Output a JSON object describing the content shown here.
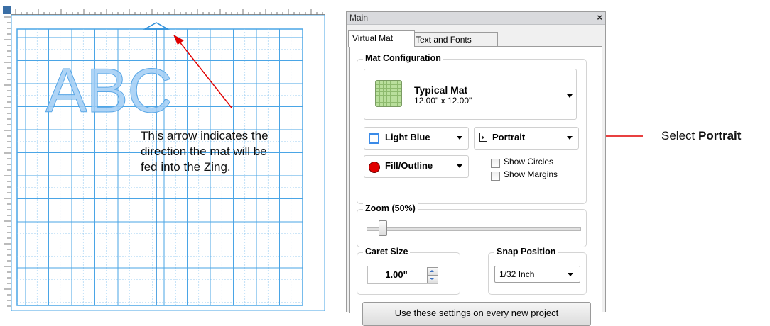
{
  "mat_view": {
    "letters": "ABC",
    "annotation": {
      "line1": "This arrow indicates the",
      "line2": "direction the mat will be",
      "line3": "fed into the Zing."
    },
    "colors": {
      "grid": "#4aa5e6",
      "letters": "#7fc0f0",
      "arrow": "#e00000"
    }
  },
  "settings_window": {
    "title": "Main",
    "close_glyph": "×",
    "tabs": [
      {
        "label": "Virtual Mat",
        "selected": true
      },
      {
        "label": "Text and Fonts",
        "selected": false
      }
    ],
    "mat_configuration": {
      "title": "Mat Configuration",
      "mat_name": "Typical Mat",
      "mat_size": "12.00\" x 12.00\"",
      "color": "Light Blue",
      "orientation": "Portrait",
      "display_mode": "Fill/Outline",
      "show_circles": {
        "label": "Show Circles",
        "checked": false
      },
      "show_margins": {
        "label": "Show Margins",
        "checked": false
      }
    },
    "zoom": {
      "title": "Zoom (50%)",
      "percent": 50
    },
    "caret_size": {
      "title": "Caret Size",
      "value": "1.00\""
    },
    "snap_position": {
      "title": "Snap Position",
      "value": "1/32 Inch"
    },
    "apply_button": "Use these settings on every new project"
  },
  "callout": {
    "prefix": "Select ",
    "emphasis": "Portrait"
  }
}
